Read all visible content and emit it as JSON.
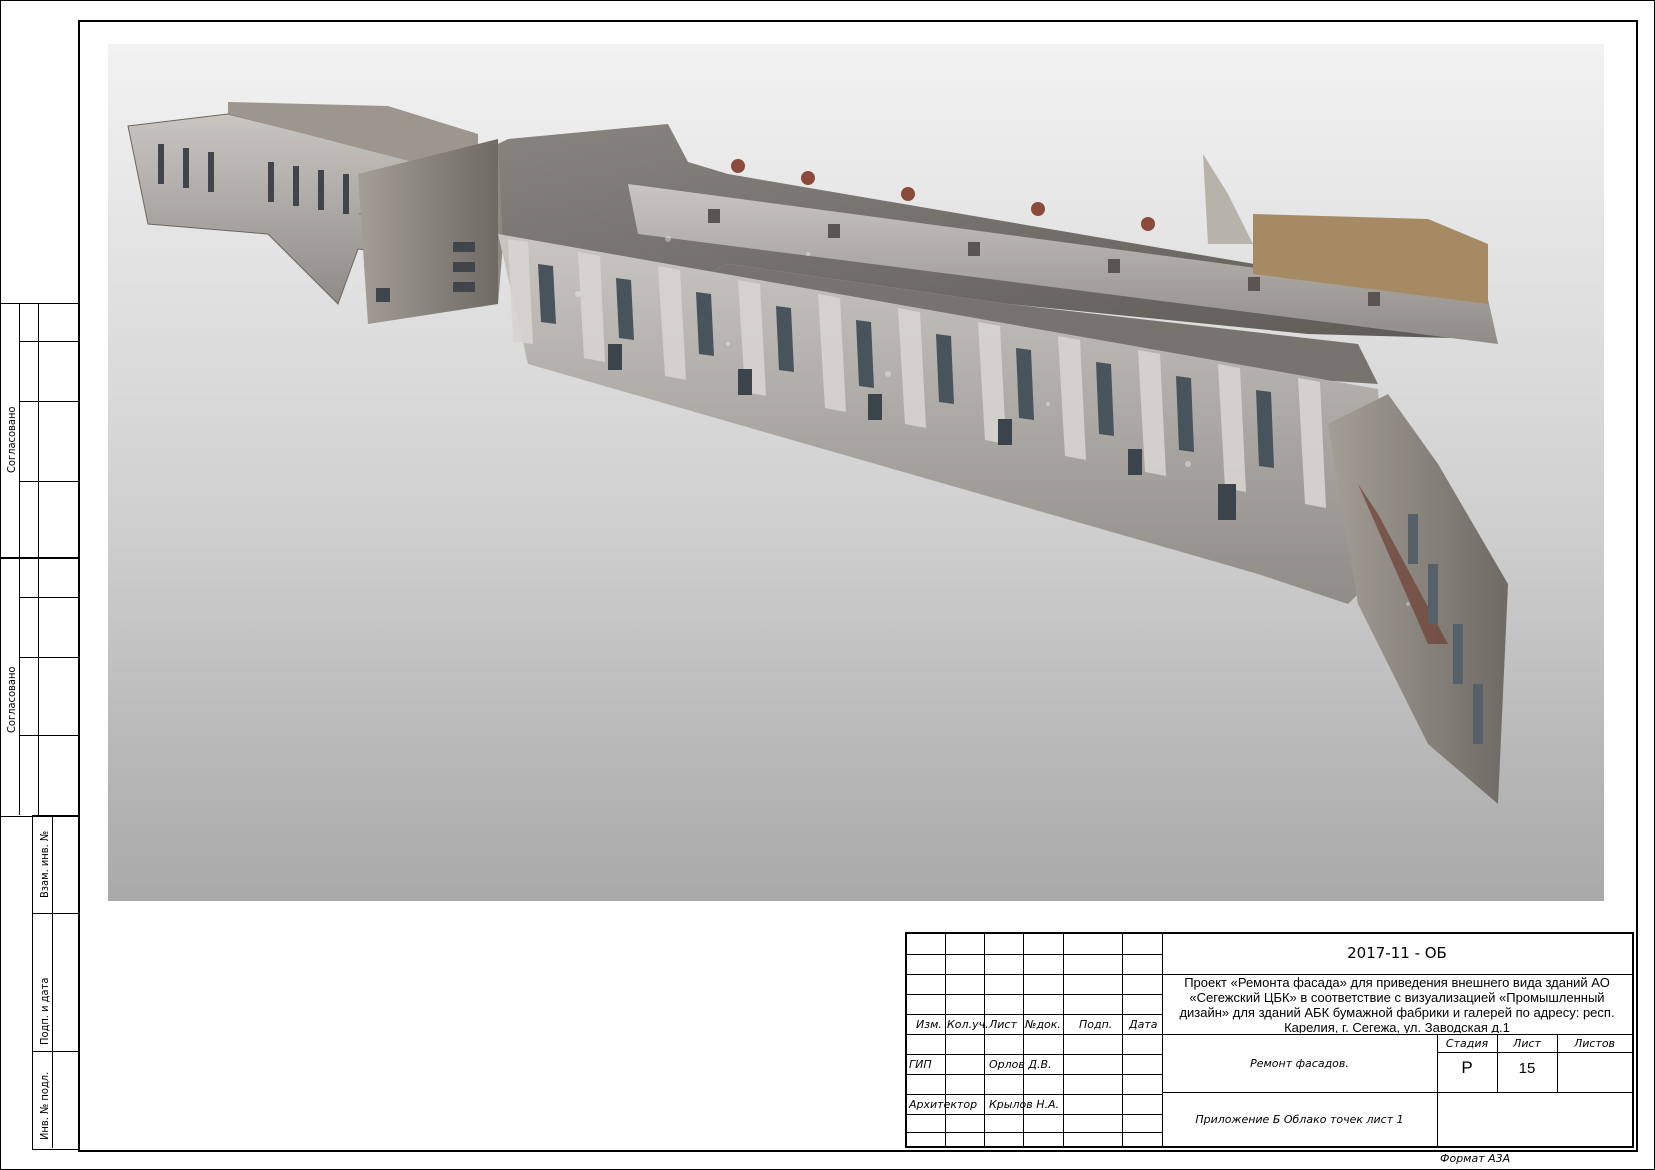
{
  "side_stamps": {
    "agreed_1": "Согласовано",
    "agreed_2": "Согласовано",
    "vzam_inv": "Взам. инв. №",
    "podp_data": "Подп. и дата",
    "inv_podl": "Инв. № подл."
  },
  "title_block": {
    "doc_code": "2017-11 - ОБ",
    "project_title": "Проект «Ремонта фасада» для приведения внешнего вида зданий АО «Сегежский ЦБК» в соответствие с визуализацией «Промышленный дизайн» для зданий АБК бумажной фабрики и галерей по адресу: респ. Карелия, г. Сегежа, ул. Заводская д.1",
    "headers": {
      "izm": "Изм.",
      "kol_uch": "Кол.уч.",
      "list": "Лист",
      "n_dok": "№док.",
      "podp": "Подп.",
      "data": "Дата"
    },
    "roles": [
      {
        "role": "ГИП",
        "name": "Орлов Д.В."
      },
      {
        "role": "Архитектор",
        "name": "Крылов Н.А."
      }
    ],
    "section_title": "Ремонт фасадов.",
    "sheet_title": "Приложение Б Облако точек лист 1",
    "stage_header": "Стадия",
    "sheet_header": "Лист",
    "sheets_header": "Листов",
    "stage_value": "Р",
    "sheet_value": "15",
    "sheets_value": "",
    "format": "Формат А3А"
  }
}
